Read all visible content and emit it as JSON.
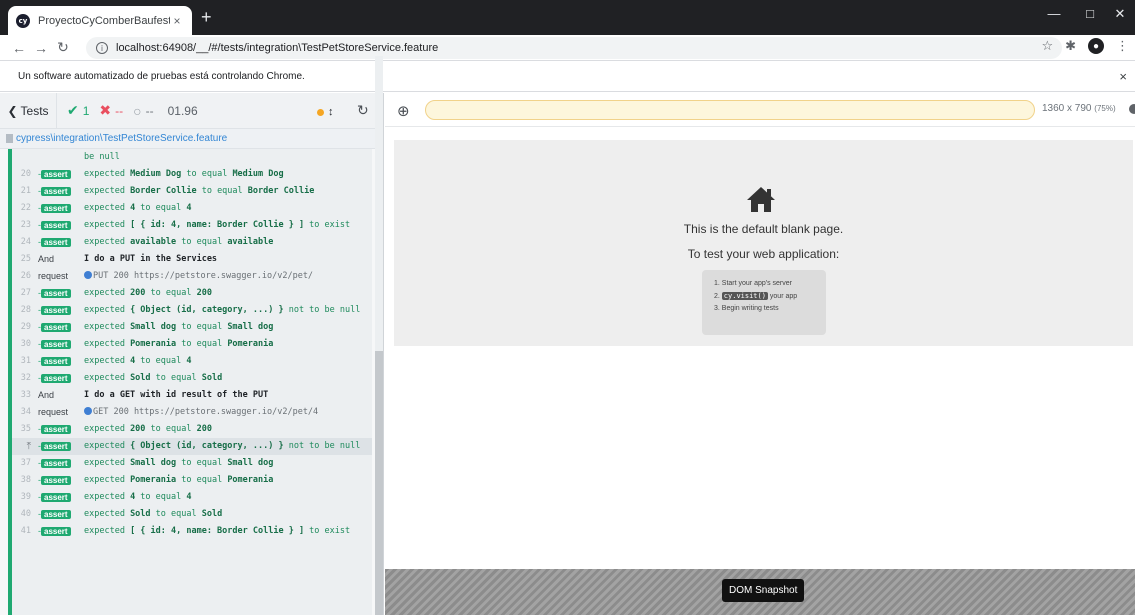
{
  "browser": {
    "tab_title": "ProyectoCyComberBaufest",
    "favicon_text": "cy",
    "tab_close": "×",
    "new_tab": "+",
    "url": "localhost:64908/__/#/tests/integration\\TestPetStoreService.feature",
    "infobar_message": "Un software automatizado de pruebas está controlando Chrome.",
    "infobar_close": "×"
  },
  "reporter": {
    "tests_label": "Tests",
    "passed": "1",
    "failed": "--",
    "pending": "--",
    "duration": "01.96",
    "spec_path": "cypress\\integration\\TestPetStoreService.feature"
  },
  "command_log": [
    {
      "num": "",
      "cmd": "",
      "parts": [
        [
          "",
          "be null"
        ]
      ],
      "type": "cont"
    },
    {
      "num": "20",
      "cmd": "assert",
      "parts": [
        [
          "",
          "expected "
        ],
        [
          "b",
          "Medium Dog"
        ],
        [
          "",
          " to equal "
        ],
        [
          "b",
          "Medium Dog"
        ]
      ]
    },
    {
      "num": "21",
      "cmd": "assert",
      "parts": [
        [
          "",
          "expected "
        ],
        [
          "b",
          "Border Collie"
        ],
        [
          "",
          " to equal "
        ],
        [
          "b",
          "Border Collie"
        ]
      ]
    },
    {
      "num": "22",
      "cmd": "assert",
      "parts": [
        [
          "",
          "expected "
        ],
        [
          "b",
          "4"
        ],
        [
          "",
          " to equal "
        ],
        [
          "b",
          "4"
        ]
      ]
    },
    {
      "num": "23",
      "cmd": "assert",
      "parts": [
        [
          "",
          "expected "
        ],
        [
          "b",
          "[ { id: 4, name: Border Collie } ]"
        ],
        [
          "",
          " to exist"
        ]
      ]
    },
    {
      "num": "24",
      "cmd": "assert",
      "parts": [
        [
          "",
          "expected "
        ],
        [
          "b",
          "available"
        ],
        [
          "",
          " to equal "
        ],
        [
          "b",
          "available"
        ]
      ]
    },
    {
      "num": "25",
      "cmd": "And",
      "parts": [
        [
          "",
          "I do a PUT in the Services"
        ]
      ],
      "type": "step"
    },
    {
      "num": "26",
      "cmd": "request",
      "parts": [
        [
          "dot",
          ""
        ],
        [
          "",
          "PUT 200 https://petstore.swagger.io/v2/pet/"
        ]
      ],
      "type": "req"
    },
    {
      "num": "27",
      "cmd": "assert",
      "parts": [
        [
          "",
          "expected "
        ],
        [
          "b",
          "200"
        ],
        [
          "",
          " to equal "
        ],
        [
          "b",
          "200"
        ]
      ]
    },
    {
      "num": "28",
      "cmd": "assert",
      "parts": [
        [
          "",
          "expected "
        ],
        [
          "b",
          "{ Object (id, category, ...) }"
        ],
        [
          "",
          " not to be null"
        ]
      ]
    },
    {
      "num": "29",
      "cmd": "assert",
      "parts": [
        [
          "",
          "expected "
        ],
        [
          "b",
          "Small dog"
        ],
        [
          "",
          " to equal "
        ],
        [
          "b",
          "Small dog"
        ]
      ]
    },
    {
      "num": "30",
      "cmd": "assert",
      "parts": [
        [
          "",
          "expected "
        ],
        [
          "b",
          "Pomerania"
        ],
        [
          "",
          " to equal "
        ],
        [
          "b",
          "Pomerania"
        ]
      ]
    },
    {
      "num": "31",
      "cmd": "assert",
      "parts": [
        [
          "",
          "expected "
        ],
        [
          "b",
          "4"
        ],
        [
          "",
          " to equal "
        ],
        [
          "b",
          "4"
        ]
      ]
    },
    {
      "num": "32",
      "cmd": "assert",
      "parts": [
        [
          "",
          "expected "
        ],
        [
          "b",
          "Sold"
        ],
        [
          "",
          " to equal "
        ],
        [
          "b",
          "Sold"
        ]
      ]
    },
    {
      "num": "33",
      "cmd": "And",
      "parts": [
        [
          "",
          "I do a GET with id result of the PUT"
        ]
      ],
      "type": "step"
    },
    {
      "num": "34",
      "cmd": "request",
      "parts": [
        [
          "dot",
          ""
        ],
        [
          "",
          "GET 200 https://petstore.swagger.io/v2/pet/4"
        ]
      ],
      "type": "req"
    },
    {
      "num": "35",
      "cmd": "assert",
      "parts": [
        [
          "",
          "expected "
        ],
        [
          "b",
          "200"
        ],
        [
          "",
          " to equal "
        ],
        [
          "b",
          "200"
        ]
      ]
    },
    {
      "num": "pin",
      "cmd": "assert",
      "parts": [
        [
          "",
          "expected "
        ],
        [
          "b",
          "{ Object (id, category, ...) }"
        ],
        [
          "",
          " not to be null"
        ]
      ],
      "type": "hl"
    },
    {
      "num": "37",
      "cmd": "assert",
      "parts": [
        [
          "",
          "expected "
        ],
        [
          "b",
          "Small dog"
        ],
        [
          "",
          " to equal "
        ],
        [
          "b",
          "Small dog"
        ]
      ]
    },
    {
      "num": "38",
      "cmd": "assert",
      "parts": [
        [
          "",
          "expected "
        ],
        [
          "b",
          "Pomerania"
        ],
        [
          "",
          " to equal "
        ],
        [
          "b",
          "Pomerania"
        ]
      ]
    },
    {
      "num": "39",
      "cmd": "assert",
      "parts": [
        [
          "",
          "expected "
        ],
        [
          "b",
          "4"
        ],
        [
          "",
          " to equal "
        ],
        [
          "b",
          "4"
        ]
      ]
    },
    {
      "num": "40",
      "cmd": "assert",
      "parts": [
        [
          "",
          "expected "
        ],
        [
          "b",
          "Sold"
        ],
        [
          "",
          " to equal "
        ],
        [
          "b",
          "Sold"
        ]
      ]
    },
    {
      "num": "41",
      "cmd": "assert",
      "parts": [
        [
          "",
          "expected "
        ],
        [
          "b",
          "[ { id: 4, name: Border Collie } ]"
        ],
        [
          "",
          " to exist"
        ]
      ]
    }
  ],
  "aut": {
    "viewport": "1360 x 790",
    "scale": "(75%)",
    "blank_title": "This is the default blank page.",
    "blank_sub": "To test your web application:",
    "steps": [
      "1. Start your app's server",
      "your app",
      "3. Begin writing tests"
    ],
    "step2_prefix": "2.",
    "step2_code": "cy.visit()",
    "snapshot_label": "DOM Snapshot"
  },
  "colors": {
    "pass": "#1fa971",
    "fail": "#e94f5f",
    "spec_link": "#3386d4",
    "autoscroll_dot": "#f5a623"
  },
  "icons": [
    "house-icon",
    "crosshair-icon",
    "rerun-icon",
    "pin-icon",
    "check-icon",
    "x-icon",
    "pending-circle-icon"
  ]
}
